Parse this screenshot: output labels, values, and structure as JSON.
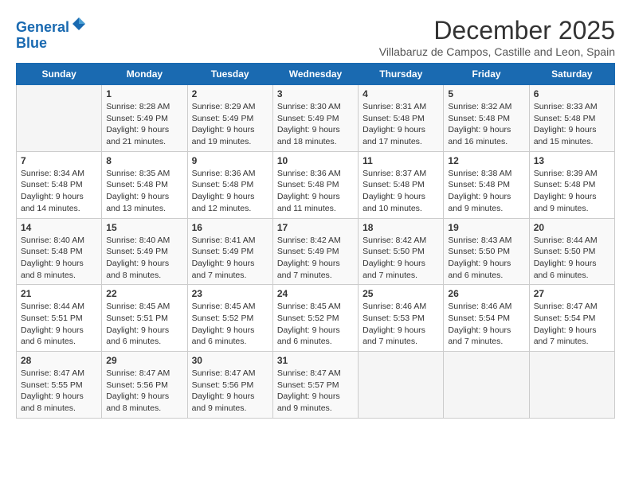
{
  "header": {
    "logo_line1": "General",
    "logo_line2": "Blue",
    "title": "December 2025",
    "location": "Villabaruz de Campos, Castille and Leon, Spain"
  },
  "columns": [
    "Sunday",
    "Monday",
    "Tuesday",
    "Wednesday",
    "Thursday",
    "Friday",
    "Saturday"
  ],
  "weeks": [
    [
      {
        "day": "",
        "empty": true
      },
      {
        "day": "1",
        "sunrise": "Sunrise: 8:28 AM",
        "sunset": "Sunset: 5:49 PM",
        "daylight": "Daylight: 9 hours and 21 minutes."
      },
      {
        "day": "2",
        "sunrise": "Sunrise: 8:29 AM",
        "sunset": "Sunset: 5:49 PM",
        "daylight": "Daylight: 9 hours and 19 minutes."
      },
      {
        "day": "3",
        "sunrise": "Sunrise: 8:30 AM",
        "sunset": "Sunset: 5:49 PM",
        "daylight": "Daylight: 9 hours and 18 minutes."
      },
      {
        "day": "4",
        "sunrise": "Sunrise: 8:31 AM",
        "sunset": "Sunset: 5:48 PM",
        "daylight": "Daylight: 9 hours and 17 minutes."
      },
      {
        "day": "5",
        "sunrise": "Sunrise: 8:32 AM",
        "sunset": "Sunset: 5:48 PM",
        "daylight": "Daylight: 9 hours and 16 minutes."
      },
      {
        "day": "6",
        "sunrise": "Sunrise: 8:33 AM",
        "sunset": "Sunset: 5:48 PM",
        "daylight": "Daylight: 9 hours and 15 minutes."
      }
    ],
    [
      {
        "day": "7",
        "sunrise": "Sunrise: 8:34 AM",
        "sunset": "Sunset: 5:48 PM",
        "daylight": "Daylight: 9 hours and 14 minutes."
      },
      {
        "day": "8",
        "sunrise": "Sunrise: 8:35 AM",
        "sunset": "Sunset: 5:48 PM",
        "daylight": "Daylight: 9 hours and 13 minutes."
      },
      {
        "day": "9",
        "sunrise": "Sunrise: 8:36 AM",
        "sunset": "Sunset: 5:48 PM",
        "daylight": "Daylight: 9 hours and 12 minutes."
      },
      {
        "day": "10",
        "sunrise": "Sunrise: 8:36 AM",
        "sunset": "Sunset: 5:48 PM",
        "daylight": "Daylight: 9 hours and 11 minutes."
      },
      {
        "day": "11",
        "sunrise": "Sunrise: 8:37 AM",
        "sunset": "Sunset: 5:48 PM",
        "daylight": "Daylight: 9 hours and 10 minutes."
      },
      {
        "day": "12",
        "sunrise": "Sunrise: 8:38 AM",
        "sunset": "Sunset: 5:48 PM",
        "daylight": "Daylight: 9 hours and 9 minutes."
      },
      {
        "day": "13",
        "sunrise": "Sunrise: 8:39 AM",
        "sunset": "Sunset: 5:48 PM",
        "daylight": "Daylight: 9 hours and 9 minutes."
      }
    ],
    [
      {
        "day": "14",
        "sunrise": "Sunrise: 8:40 AM",
        "sunset": "Sunset: 5:48 PM",
        "daylight": "Daylight: 9 hours and 8 minutes."
      },
      {
        "day": "15",
        "sunrise": "Sunrise: 8:40 AM",
        "sunset": "Sunset: 5:49 PM",
        "daylight": "Daylight: 9 hours and 8 minutes."
      },
      {
        "day": "16",
        "sunrise": "Sunrise: 8:41 AM",
        "sunset": "Sunset: 5:49 PM",
        "daylight": "Daylight: 9 hours and 7 minutes."
      },
      {
        "day": "17",
        "sunrise": "Sunrise: 8:42 AM",
        "sunset": "Sunset: 5:49 PM",
        "daylight": "Daylight: 9 hours and 7 minutes."
      },
      {
        "day": "18",
        "sunrise": "Sunrise: 8:42 AM",
        "sunset": "Sunset: 5:50 PM",
        "daylight": "Daylight: 9 hours and 7 minutes."
      },
      {
        "day": "19",
        "sunrise": "Sunrise: 8:43 AM",
        "sunset": "Sunset: 5:50 PM",
        "daylight": "Daylight: 9 hours and 6 minutes."
      },
      {
        "day": "20",
        "sunrise": "Sunrise: 8:44 AM",
        "sunset": "Sunset: 5:50 PM",
        "daylight": "Daylight: 9 hours and 6 minutes."
      }
    ],
    [
      {
        "day": "21",
        "sunrise": "Sunrise: 8:44 AM",
        "sunset": "Sunset: 5:51 PM",
        "daylight": "Daylight: 9 hours and 6 minutes."
      },
      {
        "day": "22",
        "sunrise": "Sunrise: 8:45 AM",
        "sunset": "Sunset: 5:51 PM",
        "daylight": "Daylight: 9 hours and 6 minutes."
      },
      {
        "day": "23",
        "sunrise": "Sunrise: 8:45 AM",
        "sunset": "Sunset: 5:52 PM",
        "daylight": "Daylight: 9 hours and 6 minutes."
      },
      {
        "day": "24",
        "sunrise": "Sunrise: 8:45 AM",
        "sunset": "Sunset: 5:52 PM",
        "daylight": "Daylight: 9 hours and 6 minutes."
      },
      {
        "day": "25",
        "sunrise": "Sunrise: 8:46 AM",
        "sunset": "Sunset: 5:53 PM",
        "daylight": "Daylight: 9 hours and 7 minutes."
      },
      {
        "day": "26",
        "sunrise": "Sunrise: 8:46 AM",
        "sunset": "Sunset: 5:54 PM",
        "daylight": "Daylight: 9 hours and 7 minutes."
      },
      {
        "day": "27",
        "sunrise": "Sunrise: 8:47 AM",
        "sunset": "Sunset: 5:54 PM",
        "daylight": "Daylight: 9 hours and 7 minutes."
      }
    ],
    [
      {
        "day": "28",
        "sunrise": "Sunrise: 8:47 AM",
        "sunset": "Sunset: 5:55 PM",
        "daylight": "Daylight: 9 hours and 8 minutes."
      },
      {
        "day": "29",
        "sunrise": "Sunrise: 8:47 AM",
        "sunset": "Sunset: 5:56 PM",
        "daylight": "Daylight: 9 hours and 8 minutes."
      },
      {
        "day": "30",
        "sunrise": "Sunrise: 8:47 AM",
        "sunset": "Sunset: 5:56 PM",
        "daylight": "Daylight: 9 hours and 9 minutes."
      },
      {
        "day": "31",
        "sunrise": "Sunrise: 8:47 AM",
        "sunset": "Sunset: 5:57 PM",
        "daylight": "Daylight: 9 hours and 9 minutes."
      },
      {
        "day": "",
        "empty": true
      },
      {
        "day": "",
        "empty": true
      },
      {
        "day": "",
        "empty": true
      }
    ]
  ]
}
